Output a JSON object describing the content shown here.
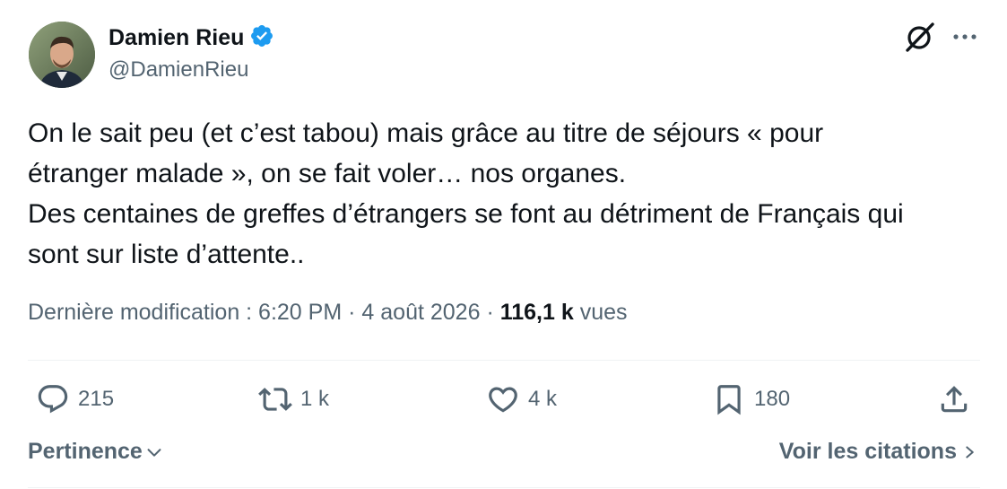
{
  "author": {
    "name": "Damien Rieu",
    "handle": "@DamienRieu",
    "verified": true
  },
  "tweet": {
    "lines": [
      "On le sait peu (et c’est tabou) mais grâce au titre de séjours « pour",
      "étranger malade », on se fait voler… nos organes.",
      "Des centaines de greffes d’étrangers se font au détriment de Français qui",
      "sont sur liste d’attente.."
    ]
  },
  "meta": {
    "edited_label": "Dernière modification : 6:20 PM",
    "separator": "·",
    "date": "4 août 2026",
    "views_count": "116,1 k",
    "views_label": "vues"
  },
  "actions": {
    "replies": "215",
    "reposts": "1 k",
    "likes": "4 k",
    "bookmarks": "180"
  },
  "footer": {
    "sort_label": "Pertinence",
    "quotes_label": "Voir les citations"
  },
  "colors": {
    "verified_blue": "#1d9bf0",
    "text_primary": "#0f1419",
    "text_secondary": "#536471",
    "divider": "#eff3f4"
  }
}
